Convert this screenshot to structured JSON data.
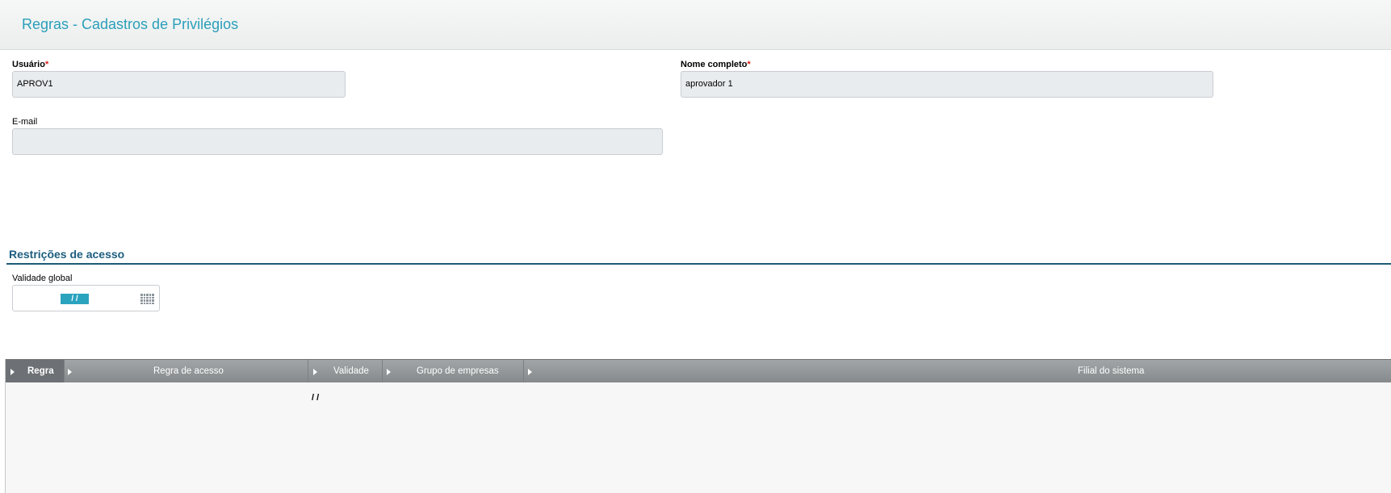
{
  "header": {
    "title": "Regras - Cadastros de Privilégios"
  },
  "form": {
    "usuario": {
      "label": "Usuário",
      "required_mark": "*",
      "value": "APROV1"
    },
    "nome_completo": {
      "label": "Nome completo",
      "required_mark": "*",
      "value": "aprovador 1"
    },
    "email": {
      "label": "E-mail",
      "value": ""
    }
  },
  "restricoes": {
    "title": "Restrições de acesso",
    "validade_global": {
      "label": "Validade global",
      "value": "/ /"
    }
  },
  "grid": {
    "columns": [
      {
        "label": "Regra"
      },
      {
        "label": "Regra de acesso"
      },
      {
        "label": "Validade"
      },
      {
        "label": "Grupo de empresas"
      },
      {
        "label": "Filial do sistema"
      }
    ],
    "rows": [
      {
        "validade": "/ /"
      }
    ]
  },
  "colors": {
    "title": "#2a9fb9",
    "section": "#1d5e7f",
    "required": "#d9231d",
    "date_highlight": "#2aa3bf"
  },
  "icons": {
    "calendar": "calendar-icon",
    "column_menu": "triangle-right-icon"
  }
}
